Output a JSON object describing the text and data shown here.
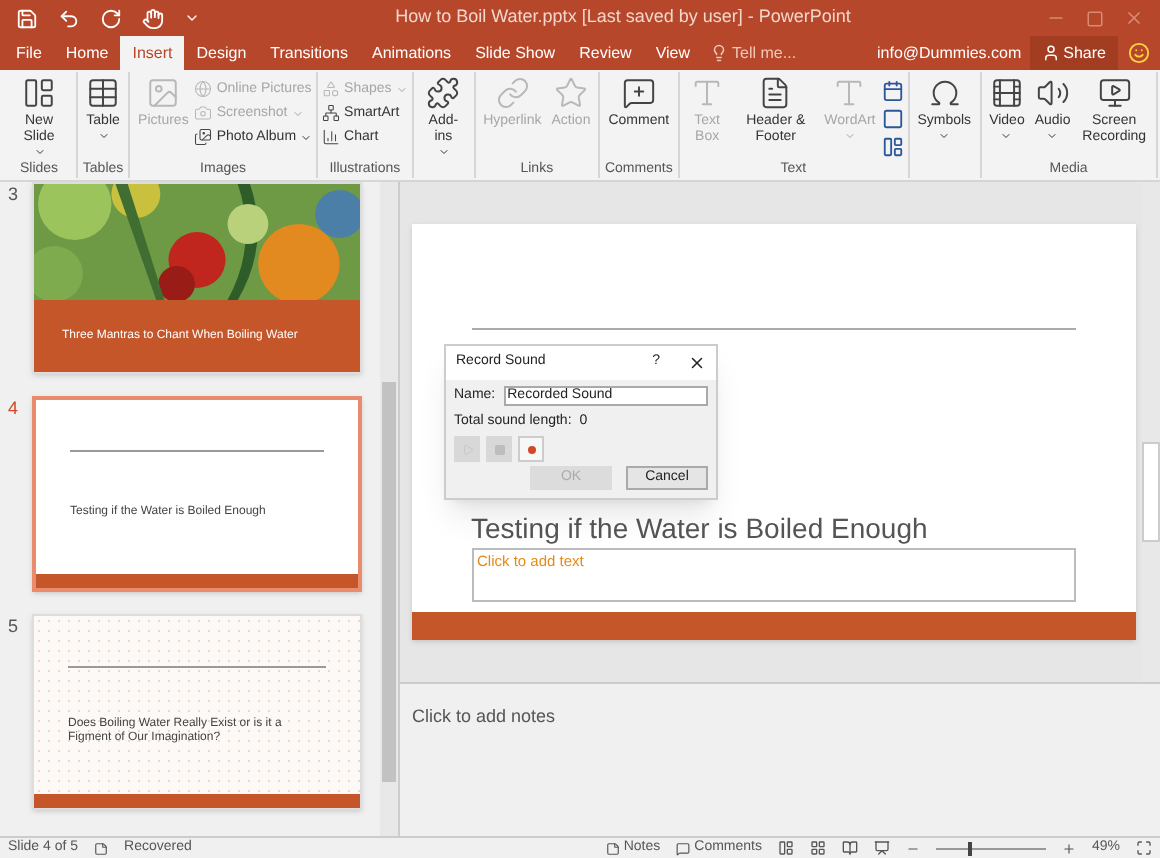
{
  "title_bar": {
    "title": "How to Boil Water.pptx [Last saved by user] - PowerPoint"
  },
  "tabs": [
    {
      "label": "File",
      "selected": false
    },
    {
      "label": "Home",
      "selected": false
    },
    {
      "label": "Insert",
      "selected": true
    },
    {
      "label": "Design",
      "selected": false
    },
    {
      "label": "Transitions",
      "selected": false
    },
    {
      "label": "Animations",
      "selected": false
    },
    {
      "label": "Slide Show",
      "selected": false
    },
    {
      "label": "Review",
      "selected": false
    },
    {
      "label": "View",
      "selected": false
    }
  ],
  "tell_me": "Tell me...",
  "account": "info@Dummies.com",
  "share": "Share",
  "ribbon": [
    {
      "label": "Slides",
      "buttons": [
        {
          "kind": "large",
          "label": "New Slide",
          "dropdown": true,
          "disabled": false
        }
      ]
    },
    {
      "label": "Tables",
      "buttons": [
        {
          "kind": "large",
          "label": "Table",
          "dropdown": true,
          "disabled": false
        }
      ]
    },
    {
      "label": "Images",
      "buttons": [
        {
          "kind": "large",
          "label": "Pictures",
          "dropdown": false,
          "disabled": true
        },
        {
          "kind": "small",
          "label": "Online Pictures",
          "dropdown": false,
          "disabled": true
        },
        {
          "kind": "small",
          "label": "Screenshot",
          "dropdown": true,
          "disabled": true
        },
        {
          "kind": "small",
          "label": "Photo Album",
          "dropdown": true,
          "disabled": false
        }
      ]
    },
    {
      "label": "Illustrations",
      "buttons": [
        {
          "kind": "small",
          "label": "Shapes",
          "dropdown": true,
          "disabled": true
        },
        {
          "kind": "small",
          "label": "SmartArt",
          "dropdown": false,
          "disabled": false
        },
        {
          "kind": "small",
          "label": "Chart",
          "dropdown": false,
          "disabled": false
        }
      ]
    },
    {
      "buttons": [
        {
          "kind": "large",
          "label": "Add-ins",
          "dropdown": true,
          "disabled": false
        }
      ]
    },
    {
      "label": "Links",
      "buttons": [
        {
          "kind": "large",
          "label": "Hyperlink",
          "dropdown": false,
          "disabled": true
        },
        {
          "kind": "large",
          "label": "Action",
          "dropdown": false,
          "disabled": true
        }
      ]
    },
    {
      "label": "Comments",
      "buttons": [
        {
          "kind": "large",
          "label": "Comment",
          "dropdown": false,
          "disabled": false
        }
      ]
    },
    {
      "label": "Text",
      "buttons": [
        {
          "kind": "large",
          "label": "Text Box",
          "dropdown": false,
          "disabled": true
        },
        {
          "kind": "large",
          "label": "Header & Footer",
          "dropdown": false,
          "disabled": false
        },
        {
          "kind": "large",
          "label": "WordArt",
          "dropdown": true,
          "disabled": true
        },
        {
          "kind": "stack"
        }
      ]
    },
    {
      "buttons": [
        {
          "kind": "large",
          "label": "Symbols",
          "dropdown": true,
          "disabled": false
        }
      ]
    },
    {
      "label": "Media",
      "buttons": [
        {
          "kind": "large",
          "label": "Video",
          "dropdown": true,
          "disabled": false
        },
        {
          "kind": "large",
          "label": "Audio",
          "dropdown": true,
          "disabled": false
        },
        {
          "kind": "large",
          "label": "Screen Recording",
          "dropdown": false,
          "disabled": false
        }
      ]
    }
  ],
  "thumbnails": [
    {
      "number": "3",
      "kind": "picture",
      "title": "Three Mantras to Chant When Boiling Water",
      "selected": false
    },
    {
      "number": "4",
      "kind": "plain",
      "title": "Testing if the Water is Boiled Enough",
      "selected": true
    },
    {
      "number": "5",
      "kind": "dotted",
      "title": "Does Boiling Water Really Exist or is it a Figment of Our Imagination?",
      "selected": false
    }
  ],
  "slide": {
    "title": "Testing if the Water is Boiled Enough",
    "placeholder": "Click to add text"
  },
  "dialog": {
    "title": "Record Sound",
    "help": "?",
    "name_label": "Name:",
    "name_value": "Recorded Sound",
    "length_label": "Total sound length:",
    "length_value": "0",
    "controls": [
      {
        "kind": "play",
        "disabled": true
      },
      {
        "kind": "stop",
        "disabled": true
      },
      {
        "kind": "record",
        "disabled": false
      }
    ],
    "buttons": [
      {
        "label": "OK",
        "disabled": true
      },
      {
        "label": "Cancel",
        "disabled": false
      }
    ]
  },
  "notes_placeholder": "Click to add notes",
  "status_bar": {
    "slide": "Slide 4 of 5",
    "state": "Recovered",
    "notes": "Notes",
    "comments": "Comments",
    "zoom": "49%",
    "zoom_slider": {
      "level": 0.3
    }
  }
}
